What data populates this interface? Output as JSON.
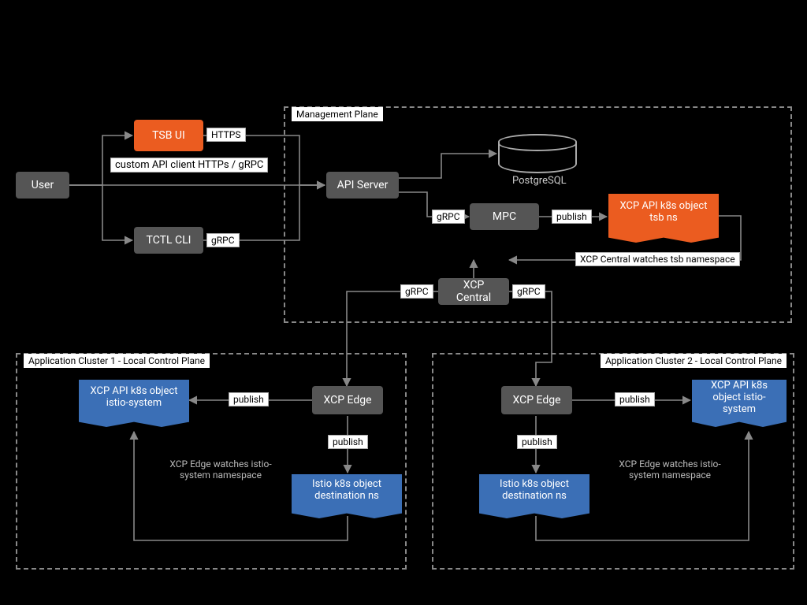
{
  "user": {
    "label": "User"
  },
  "tsb_ui": {
    "label": "TSB UI"
  },
  "tctl": {
    "label": "TCTL CLI"
  },
  "api_server": {
    "label": "API Server"
  },
  "mpc": {
    "label": "MPC"
  },
  "postgres": {
    "label": "PostgreSQL"
  },
  "xcp_central": {
    "label": "XCP Central"
  },
  "xcp_api_tsb": {
    "label": "XCP API k8s object tsb ns"
  },
  "edges": {
    "https": "HTTPS",
    "grpc": "gRPC",
    "custom_api": "custom API client HTTPs / gRPC",
    "publish": "publish",
    "watch_tsb": "XCP Central watches tsb namespace",
    "watch_istio": "XCP Edge watches istio-system namespace"
  },
  "mgmt_plane": {
    "label": "Management Plane"
  },
  "cluster1": {
    "label": "Application Cluster 1 - Local Control Plane",
    "xcp_edge": "XCP Edge",
    "xcp_api": "XCP API k8s object istio-system",
    "istio_obj": "Istio k8s object destination ns"
  },
  "cluster2": {
    "label": "Application Cluster 2 - Local Control Plane",
    "xcp_edge": "XCP Edge",
    "xcp_api": "XCP API k8s object istio-system",
    "istio_obj": "Istio k8s object destination ns"
  }
}
